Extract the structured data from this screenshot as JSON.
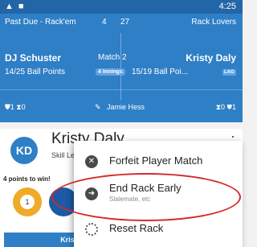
{
  "status_bar": {
    "time": "4:25",
    "icons": [
      "warning-icon",
      "square-icon"
    ]
  },
  "header": {
    "row1": {
      "status": "Past Due - Rack'em",
      "num1": "4",
      "num2": "27",
      "team": "Rack Lovers"
    },
    "player_left": {
      "name": "DJ Schuster",
      "ball_points": "14/25 Ball Points"
    },
    "match": {
      "label": "Match 2",
      "innings": "4 Innings"
    },
    "player_right": {
      "name": "Kristy Daly",
      "ball_points": "15/19 Ball Poi...",
      "badge": "LAG"
    },
    "row3": {
      "left_stats": "⛊1 ⧗0",
      "referee": "Jamie Hess",
      "right_stats": "⧗0 ⛊1"
    }
  },
  "card": {
    "avatar_initials": "KD",
    "player_name": "Kristy Daly",
    "skill": "Skill Lev",
    "points_to_win": "4 points to win!",
    "ball_number": "1",
    "bottom_label": "Kris"
  },
  "menu": {
    "items": [
      {
        "label": "Forfeit Player Match",
        "sublabel": ""
      },
      {
        "label": "End Rack Early",
        "sublabel": "Stalemate, etc"
      },
      {
        "label": "Reset Rack",
        "sublabel": ""
      }
    ]
  },
  "colors": {
    "header": "#2f7fc6",
    "status_bar": "#2266a8",
    "highlight": "#d32a2a",
    "ball_orange": "#f1a928"
  }
}
